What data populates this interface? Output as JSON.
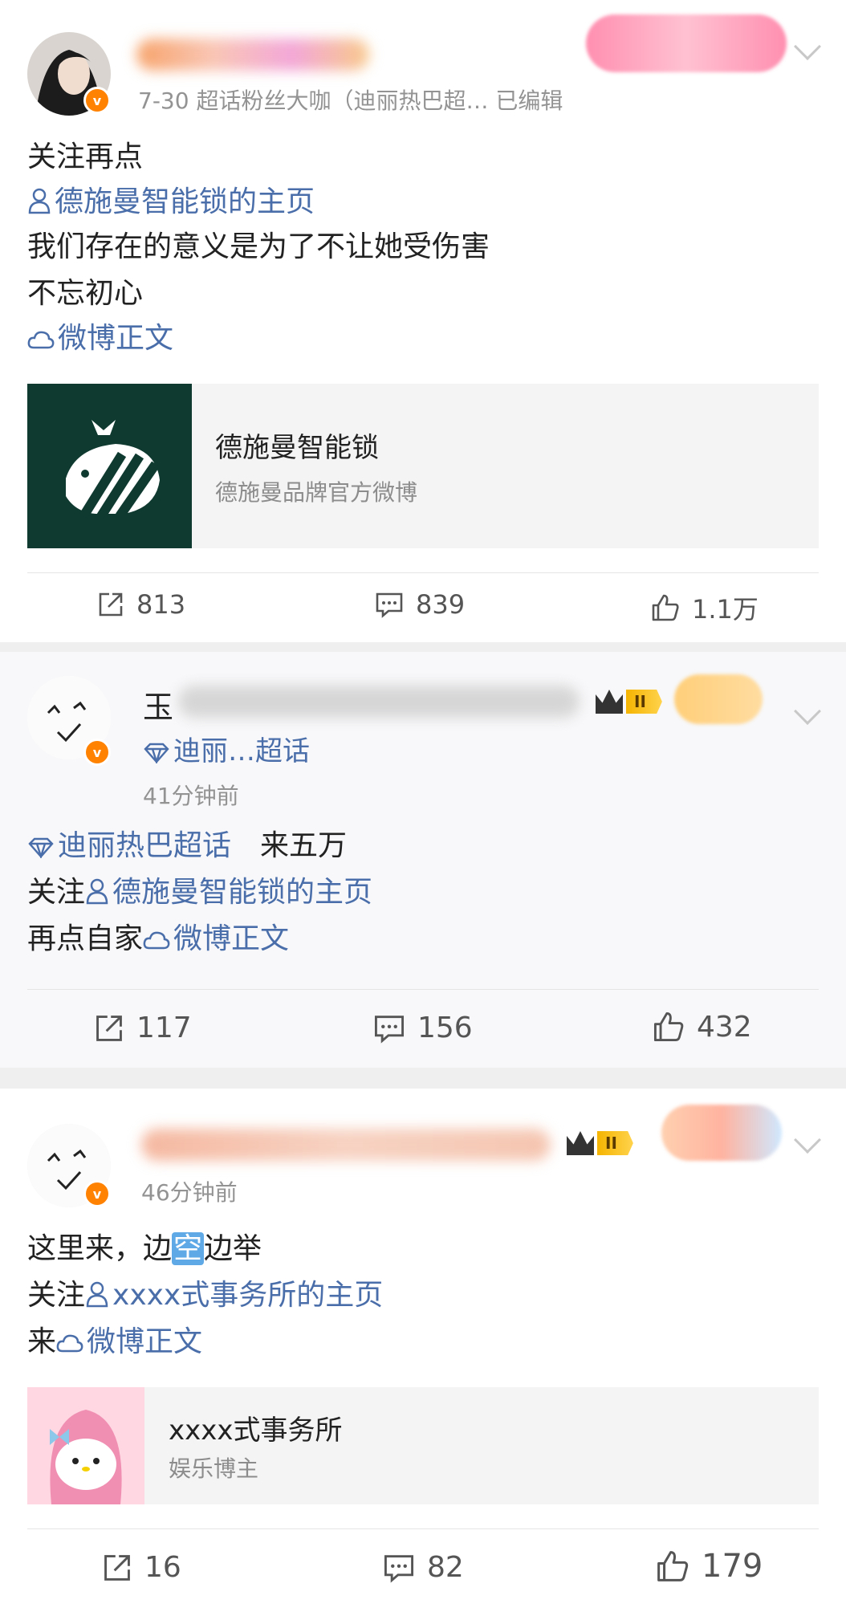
{
  "posts": [
    {
      "meta": "7-30  超话粉丝大咖（迪丽热巴超…  已编辑",
      "lines": {
        "l1": "关注再点",
        "l2_link": "德施曼智能锁的主页",
        "l3": "我们存在的意义是为了不让她受伤害",
        "l4": "不忘初心",
        "l5_link": "微博正文"
      },
      "embed": {
        "title": "德施曼智能锁",
        "subtitle": "德施曼品牌官方微博"
      },
      "actions": {
        "repost": "813",
        "comment": "839",
        "like": "1.1万"
      }
    },
    {
      "name_visible": "玉",
      "topic": "迪丽…超话",
      "time": "41分钟前",
      "lines": {
        "l1_link": "迪丽热巴超话",
        "l1_text": "来五万",
        "l2_prefix": "关注",
        "l2_link": "德施曼智能锁的主页",
        "l3_prefix": "再点自家",
        "l3_link": "微博正文"
      },
      "level_badge": "II",
      "actions": {
        "repost": "117",
        "comment": "156",
        "like": "432"
      }
    },
    {
      "time": "46分钟前",
      "lines": {
        "l1_a": "这里来，边",
        "l1_hl": "空",
        "l1_b": "边举",
        "l2_prefix": "关注",
        "l2_link": "xxxx式事务所的主页",
        "l3_prefix": "来",
        "l3_link": "微博正文"
      },
      "level_badge": "II",
      "embed": {
        "title": "xxxx式事务所",
        "subtitle": "娱乐博主"
      },
      "actions": {
        "repost": "16",
        "comment": "82",
        "like": "179"
      }
    }
  ],
  "colors": {
    "link": "#4a6ea9",
    "verified": "#ff8200",
    "brand_tile": "#0f3a30"
  },
  "icons": [
    "repost-icon",
    "comment-icon",
    "like-icon",
    "person-icon",
    "cloud-icon",
    "diamond-icon",
    "chevron-down-icon",
    "verified-icon"
  ]
}
